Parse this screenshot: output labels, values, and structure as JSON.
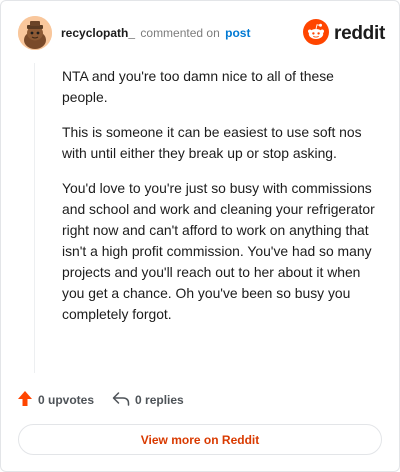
{
  "header": {
    "username": "recyclopath_",
    "action_text": "commented on",
    "post_link": "post",
    "brand": "reddit"
  },
  "comment": {
    "paragraphs": [
      "NTA and you're too damn nice to all of these people.",
      "This is someone it can be easiest to use soft nos with until either they break up or stop asking.",
      "You'd love to you're just so busy with commissions and school and work and cleaning your refrigerator right now and can't afford to work on anything that isn't a high profit commission. You've had so many projects and you'll reach out to her about it when you get a chance. Oh you've been so busy you completely forgot."
    ]
  },
  "actions": {
    "upvotes": "0 upvotes",
    "replies": "0 replies"
  },
  "footer": {
    "view_more": "View more on Reddit"
  },
  "colors": {
    "brand_orange": "#ff4500",
    "link_blue": "#0079d3",
    "view_more_text": "#d93a00"
  },
  "icons": [
    "avatar",
    "reddit-logo-icon",
    "upvote-arrow-icon",
    "reply-arrow-icon"
  ]
}
